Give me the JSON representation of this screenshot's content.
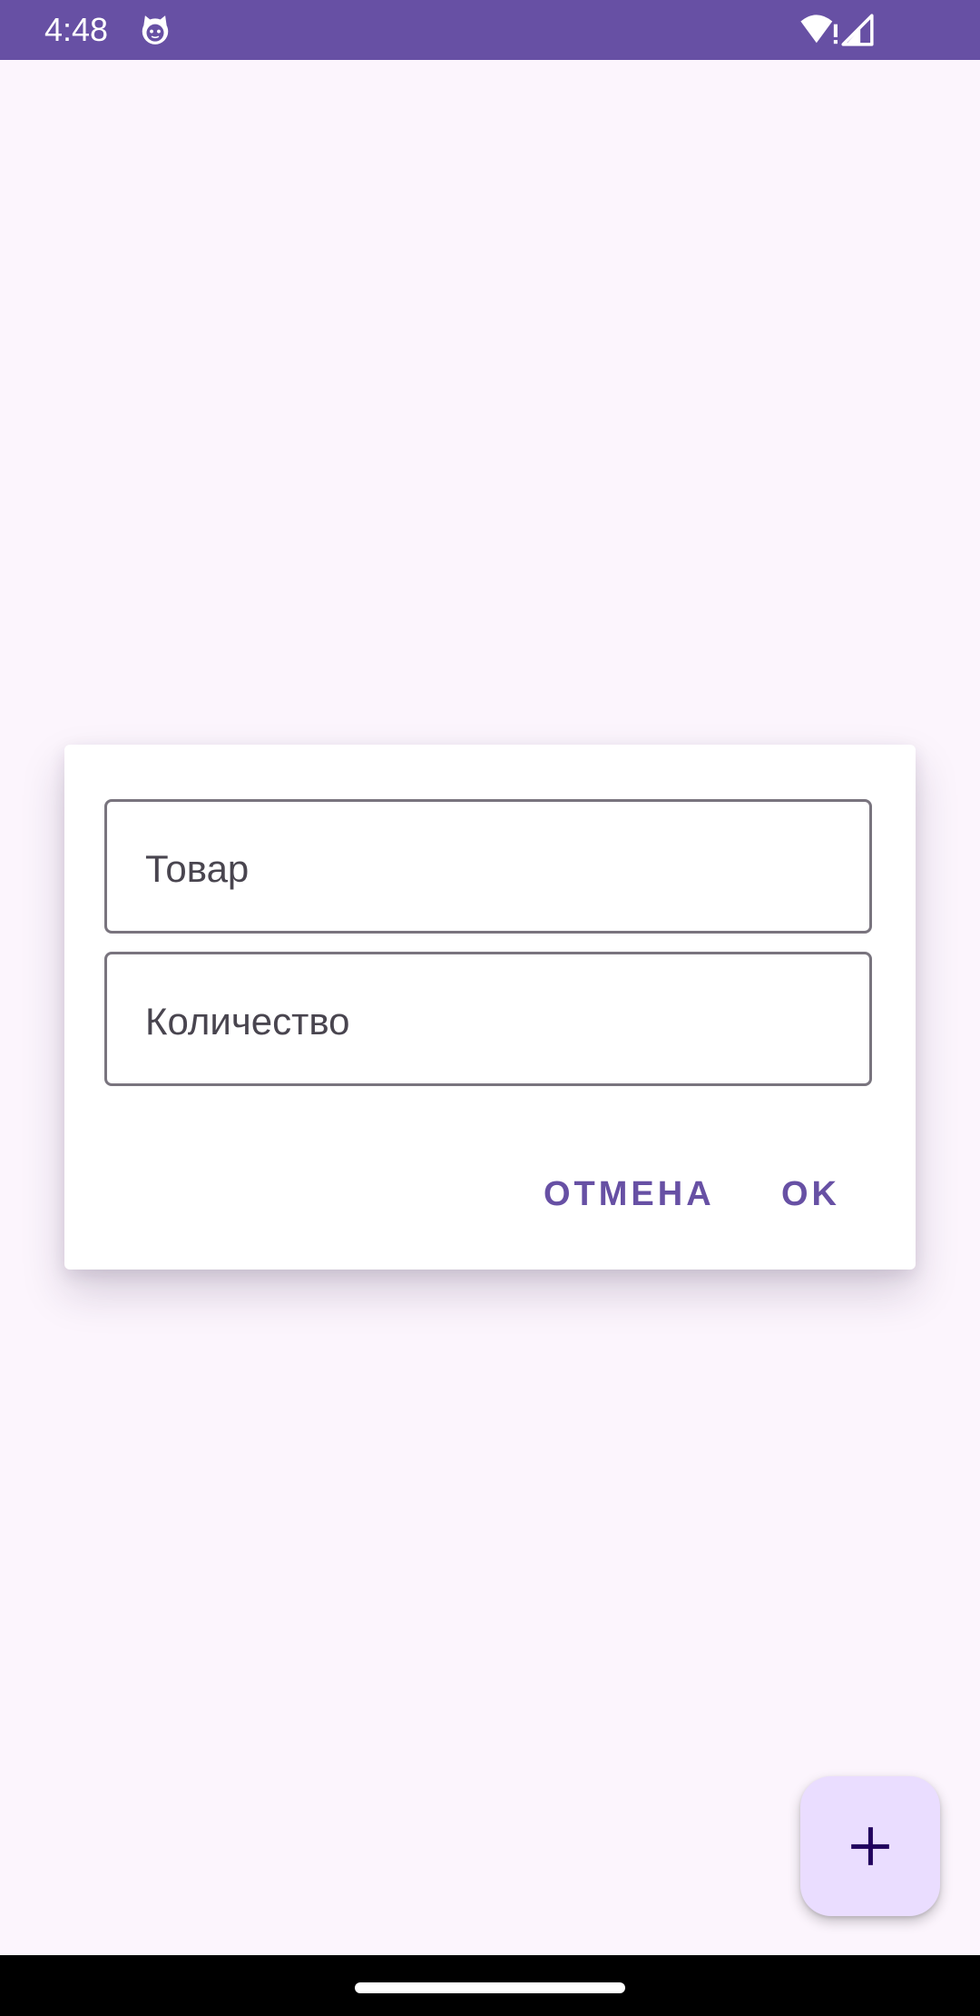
{
  "status_bar": {
    "time": "4:48",
    "app_icon": "android-cat-icon",
    "wifi_icon": "wifi-alert-icon",
    "signal_icon": "cell-signal-icon",
    "background_color": "#6750a4"
  },
  "dialog": {
    "product_field": {
      "placeholder": "Товар",
      "value": ""
    },
    "quantity_field": {
      "placeholder": "Количество",
      "value": ""
    },
    "cancel_label": "ОТМЕНА",
    "ok_label": "OK",
    "accent_color": "#6750a4"
  },
  "fab": {
    "icon": "plus-icon",
    "background_color": "#eaddff"
  }
}
